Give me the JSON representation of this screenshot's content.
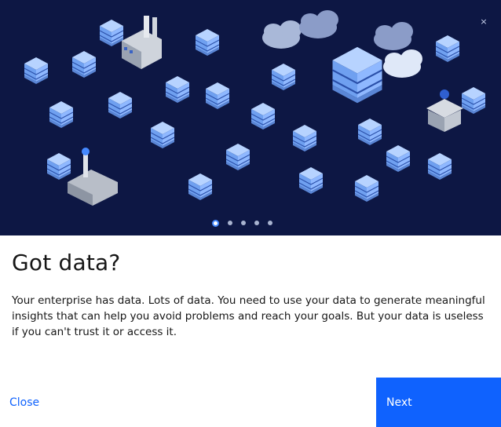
{
  "dialog": {
    "close_icon": "×",
    "title": "Got data?",
    "description": "Your enterprise has data. Lots of data. You need to use your data to generate meaningful insights that can help you avoid problems and reach your goals. But your data is useless if you can't trust it or access it.",
    "close_label": "Close",
    "next_label": "Next"
  },
  "pagination": {
    "total": 5,
    "active": 1
  },
  "hero": {
    "background": "#0d1744",
    "illustration": [
      "database-stack-icon",
      "cloud-icon",
      "factory-icon",
      "bank-icon",
      "warehouse-icon"
    ]
  },
  "colors": {
    "primary": "#0f62fe",
    "text": "#161616",
    "accent": "#4589ff"
  }
}
